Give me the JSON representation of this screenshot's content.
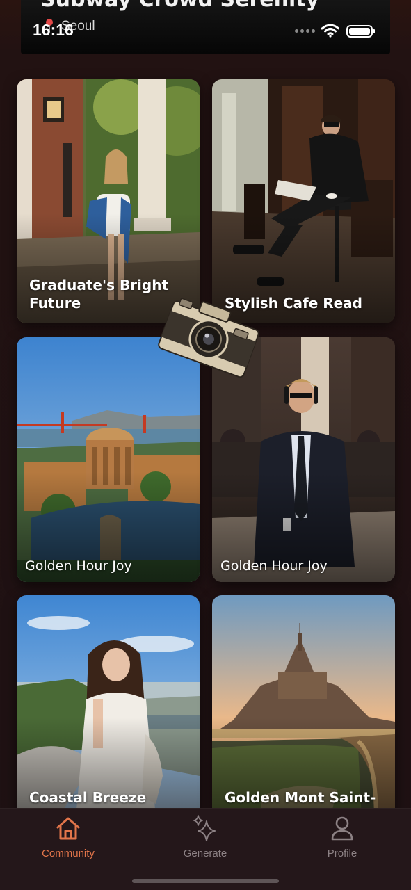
{
  "header": {
    "banner_title": "Subway Crowd Serenity",
    "status_time": "16:16",
    "status_location": "Seoul"
  },
  "cards": [
    {
      "title": "Graduate's Bright Future"
    },
    {
      "title": "Stylish Cafe Read"
    },
    {
      "title": "Golden Hour Joy"
    },
    {
      "title": "Golden Hour Joy"
    },
    {
      "title": "Coastal Breeze"
    },
    {
      "title": "Golden Mont Saint-"
    }
  ],
  "tabs": [
    {
      "label": "Community",
      "icon": "home-icon",
      "active": true
    },
    {
      "label": "Generate",
      "icon": "sparkle-icon",
      "active": false
    },
    {
      "label": "Profile",
      "icon": "person-icon",
      "active": false
    }
  ],
  "colors": {
    "background": "#1d1112",
    "accent": "#e2754a",
    "tab_inactive": "#8c8184"
  }
}
